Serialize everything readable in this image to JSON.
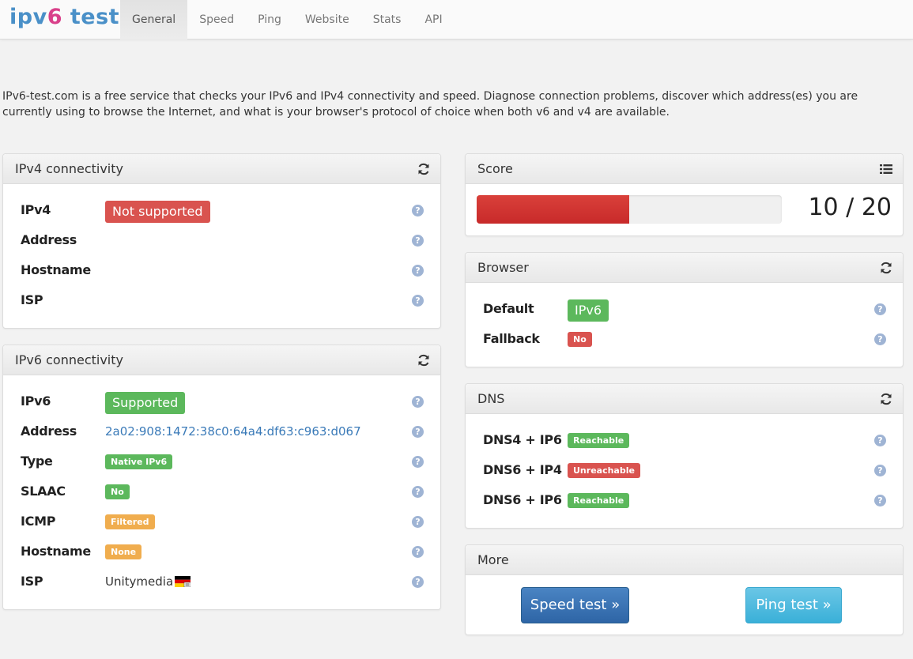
{
  "brand": {
    "part1": "ipv",
    "part2": "6",
    "part3": " test"
  },
  "nav": [
    "General",
    "Speed",
    "Ping",
    "Website",
    "Stats",
    "API"
  ],
  "intro": "IPv6-test.com is a free service that checks your IPv6 and IPv4 connectivity and speed. Diagnose connection problems, discover which address(es) you are currently using to browse the Internet, and what is your browser's protocol of choice when both v6 and v4 are available.",
  "ipv4": {
    "title": "IPv4 connectivity",
    "rows": [
      {
        "label": "IPv4",
        "value": "Not supported"
      },
      {
        "label": "Address",
        "value": ""
      },
      {
        "label": "Hostname",
        "value": ""
      },
      {
        "label": "ISP",
        "value": ""
      }
    ]
  },
  "ipv6": {
    "title": "IPv6 connectivity",
    "rows": [
      {
        "label": "IPv6",
        "value": "Supported"
      },
      {
        "label": "Address",
        "value": "2a02:908:1472:38c0:64a4:df63:c963:d067"
      },
      {
        "label": "Type",
        "value": "Native IPv6"
      },
      {
        "label": "SLAAC",
        "value": "No"
      },
      {
        "label": "ICMP",
        "value": "Filtered"
      },
      {
        "label": "Hostname",
        "value": "None"
      },
      {
        "label": "ISP",
        "value": "Unitymedia"
      }
    ]
  },
  "score": {
    "title": "Score",
    "text": "10 / 20",
    "value": 10,
    "max": 20
  },
  "browser": {
    "title": "Browser",
    "rows": [
      {
        "label": "Default",
        "value": "IPv6"
      },
      {
        "label": "Fallback",
        "value": "No"
      }
    ]
  },
  "dns": {
    "title": "DNS",
    "rows": [
      {
        "label": "DNS4 + IP6",
        "value": "Reachable"
      },
      {
        "label": "DNS6 + IP4",
        "value": "Unreachable"
      },
      {
        "label": "DNS6 + IP6",
        "value": "Reachable"
      }
    ]
  },
  "more": {
    "title": "More",
    "speed_btn": "Speed test »",
    "ping_btn": "Ping test »"
  },
  "help_glyph": "?",
  "colors": {
    "red": "#d9534f",
    "green": "#5cb85c",
    "orange": "#f0ad4e",
    "link": "#3a7ab8"
  }
}
